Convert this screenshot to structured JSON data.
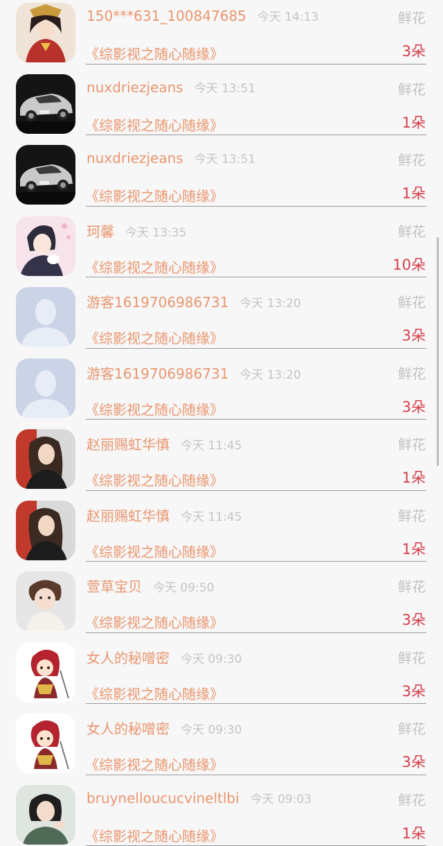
{
  "entries": [
    {
      "user": "150***631_100847685",
      "time": "今天 14:13",
      "gift": "鲜花",
      "book": "《综影视之随心随缘》",
      "count": "3朵",
      "avatar": "ancient-queen"
    },
    {
      "user": "nuxdriezjeans",
      "time": "今天 13:51",
      "gift": "鲜花",
      "book": "《综影视之随心随缘》",
      "count": "1朵",
      "avatar": "silver-car"
    },
    {
      "user": "nuxdriezjeans",
      "time": "今天 13:51",
      "gift": "鲜花",
      "book": "《综影视之随心随缘》",
      "count": "1朵",
      "avatar": "silver-car"
    },
    {
      "user": "珂馨",
      "time": "今天 13:35",
      "gift": "鲜花",
      "book": "《综影视之随心随缘》",
      "count": "10朵",
      "avatar": "anime-couple"
    },
    {
      "user": "游客1619706986731",
      "time": "今天 13:20",
      "gift": "鲜花",
      "book": "《综影视之随心随缘》",
      "count": "3朵",
      "avatar": "default-user"
    },
    {
      "user": "游客1619706986731",
      "time": "今天 13:20",
      "gift": "鲜花",
      "book": "《综影视之随心随缘》",
      "count": "3朵",
      "avatar": "default-user"
    },
    {
      "user": "赵丽赐虹华慎",
      "time": "今天 11:45",
      "gift": "鲜花",
      "book": "《综影视之随心随缘》",
      "count": "1朵",
      "avatar": "woman-photo"
    },
    {
      "user": "赵丽赐虹华慎",
      "time": "今天 11:45",
      "gift": "鲜花",
      "book": "《综影视之随心随缘》",
      "count": "1朵",
      "avatar": "woman-photo"
    },
    {
      "user": "萱草宝贝",
      "time": "今天 09:50",
      "gift": "鲜花",
      "book": "《综影视之随心随缘》",
      "count": "3朵",
      "avatar": "child-photo"
    },
    {
      "user": "女人的秘噌密",
      "time": "今天 09:30",
      "gift": "鲜花",
      "book": "《综影视之随心随缘》",
      "count": "3朵",
      "avatar": "cartoon-warrior"
    },
    {
      "user": "女人的秘噌密",
      "time": "今天 09:30",
      "gift": "鲜花",
      "book": "《综影视之随心随缘》",
      "count": "3朵",
      "avatar": "cartoon-warrior"
    },
    {
      "user": "bruynelloucucvineltlbi",
      "time": "今天 09:03",
      "gift": "鲜花",
      "book": "《综影视之随心随缘》",
      "count": "1朵",
      "avatar": "girl-photo"
    }
  ],
  "colors": {
    "username": "#e9966f",
    "timestamp": "#c4c4c4",
    "gift_label": "#c2c2c2",
    "count": "#d63d4a",
    "background": "#f7f7f7"
  }
}
